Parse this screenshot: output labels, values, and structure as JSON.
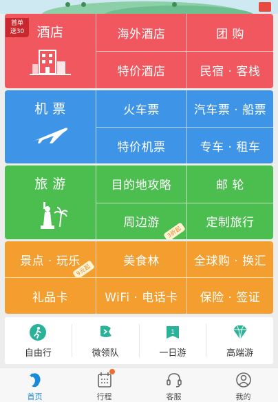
{
  "colors": {
    "hotel": "#f1575e",
    "flight": "#3e95e8",
    "travel": "#4cbd4f",
    "more": "#f49e2f",
    "active_tab": "#1a8bd8"
  },
  "hotel": {
    "badge_line1": "首单",
    "badge_line2": "送30",
    "main_label": "酒店",
    "overseas": "海外酒店",
    "group_buy": "团 购",
    "special": "特价酒店",
    "inn": "民宿 · 客栈"
  },
  "flight": {
    "main_label": "机 票",
    "train": "火车票",
    "bus_ship": "汽车票 · 船票",
    "special": "特价机票",
    "car": "专车 · 租车"
  },
  "travel": {
    "main_label": "旅 游",
    "guide": "目的地攻略",
    "cruise": "邮 轮",
    "nearby": "周边游",
    "nearby_tag": "3折起",
    "custom": "定制旅行"
  },
  "more": {
    "attractions": "景点 · 玩乐",
    "attractions_tag": "9元起",
    "food": "美食林",
    "global_shop": "全球购 · 换汇",
    "gift_card": "礼品卡",
    "wifi": "WiFi · 电话卡",
    "insurance": "保险 · 签证"
  },
  "shortcuts": [
    {
      "label": "自由行",
      "icon": "walking-person-icon"
    },
    {
      "label": "微领队",
      "icon": "flag-icon"
    },
    {
      "label": "一日游",
      "icon": "calendar-one-icon"
    },
    {
      "label": "高端游",
      "icon": "diamond-icon"
    }
  ],
  "tabs": [
    {
      "label": "首页",
      "icon": "home-dolphin-icon",
      "active": true
    },
    {
      "label": "行程",
      "icon": "itinerary-icon"
    },
    {
      "label": "客服",
      "icon": "headset-icon"
    },
    {
      "label": "我的",
      "icon": "user-icon"
    }
  ]
}
